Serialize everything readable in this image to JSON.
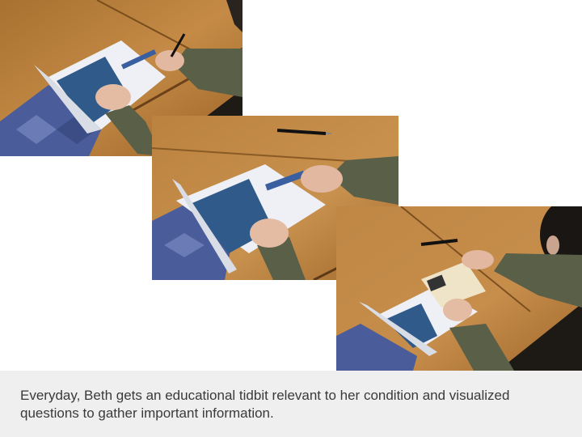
{
  "slide": {
    "caption": "Everyday, Beth gets an educational tidbit relevant to her condition and visualized questions to gather important information."
  },
  "photos": [
    {
      "name": "photo-writing-with-pen"
    },
    {
      "name": "photo-tearing-card"
    },
    {
      "name": "photo-holding-card"
    }
  ],
  "colors": {
    "caption_bar": "#efefef",
    "caption_text": "#3a3a3a",
    "table_wood": "#b8813f",
    "sleeve_green": "#5a5f48",
    "chair_blue": "#4a5c99"
  }
}
